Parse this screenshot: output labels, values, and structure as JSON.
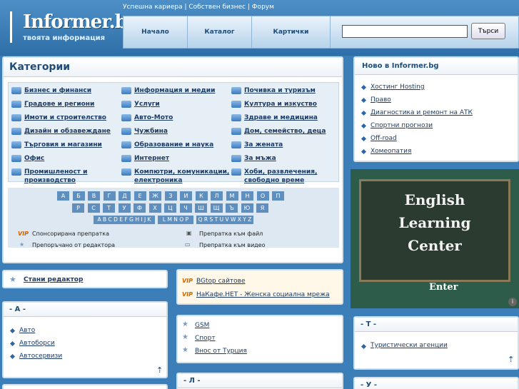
{
  "logo": {
    "name": "Informer.bg",
    "tagline": "твоята информация"
  },
  "toplinks": "Успешна кариера | Собствен бизнес | Форум",
  "nav": {
    "items": [
      "Начало",
      "Каталог",
      "Картички"
    ],
    "search_placeholder": "",
    "search_button": "Търси"
  },
  "categories": {
    "title": "Категории",
    "col1": [
      "Бизнес и финанси",
      "Градове и региони",
      "Имоти и строителство",
      "Дизайн и обзавеждане",
      "Търговия и магазини",
      "Офис",
      "Промишленост и производство"
    ],
    "col2": [
      "Информация и медии",
      "Услуги",
      "Авто-Мото",
      "Чужбина",
      "Образование и наука",
      "Интернет",
      "Компютри, комуникации, електроника"
    ],
    "col3": [
      "Почивка и туризъм",
      "Култура и изкуство",
      "Здраве и медицина",
      "Дом, семейство, деца",
      "За жената",
      "За мъжа",
      "Хоби, развлечения, свободно време"
    ]
  },
  "alphabet": {
    "row1": [
      "А",
      "Б",
      "В",
      "Г",
      "Д",
      "Е",
      "Ж",
      "З",
      "И",
      "К",
      "Л",
      "М",
      "Н",
      "О",
      "П"
    ],
    "row2": [
      "Р",
      "С",
      "Т",
      "У",
      "Ф",
      "Х",
      "Ц",
      "Ч",
      "Ш",
      "Щ",
      "Ъ",
      "Ю",
      "Я"
    ],
    "latin": [
      "A B C D E F G H I J K",
      "L M N O P",
      "Q R S T U V W X Y Z"
    ]
  },
  "legend": {
    "vip": "VIP",
    "sponsored": "Спонсорирана препратка",
    "recommended": "Препоръчано от редактора",
    "file": "Препратка към файл",
    "video": "Препратка към видео"
  },
  "news": {
    "title": "Ново в Informer.bg",
    "items": [
      "Хостинг Hosting",
      "Право",
      "Диагностика и ремонт на АТК",
      "Спортни прогнози",
      "Off-road",
      "Хомеопатия"
    ]
  },
  "ad": {
    "line1": "English",
    "line2": "Learning",
    "line3": "Center",
    "enter": "Enter"
  },
  "editor": {
    "label": "Стани редактор"
  },
  "sectionA": {
    "title": "- А -",
    "items": [
      "Авто",
      "Автоборси",
      "Автосервизи"
    ]
  },
  "vipbox": {
    "items": [
      "BGtop сайтове",
      "НаКафе.НЕТ - Женска социална мрежа"
    ]
  },
  "sectionG": {
    "items": [
      "GSM",
      "Спорт",
      "Внос от Турция"
    ]
  },
  "sectionL": {
    "title": "- Л -"
  },
  "sectionT": {
    "title": "- Т -",
    "items": [
      "Туристически агенции"
    ]
  },
  "sectionU": {
    "title": "- У -"
  }
}
